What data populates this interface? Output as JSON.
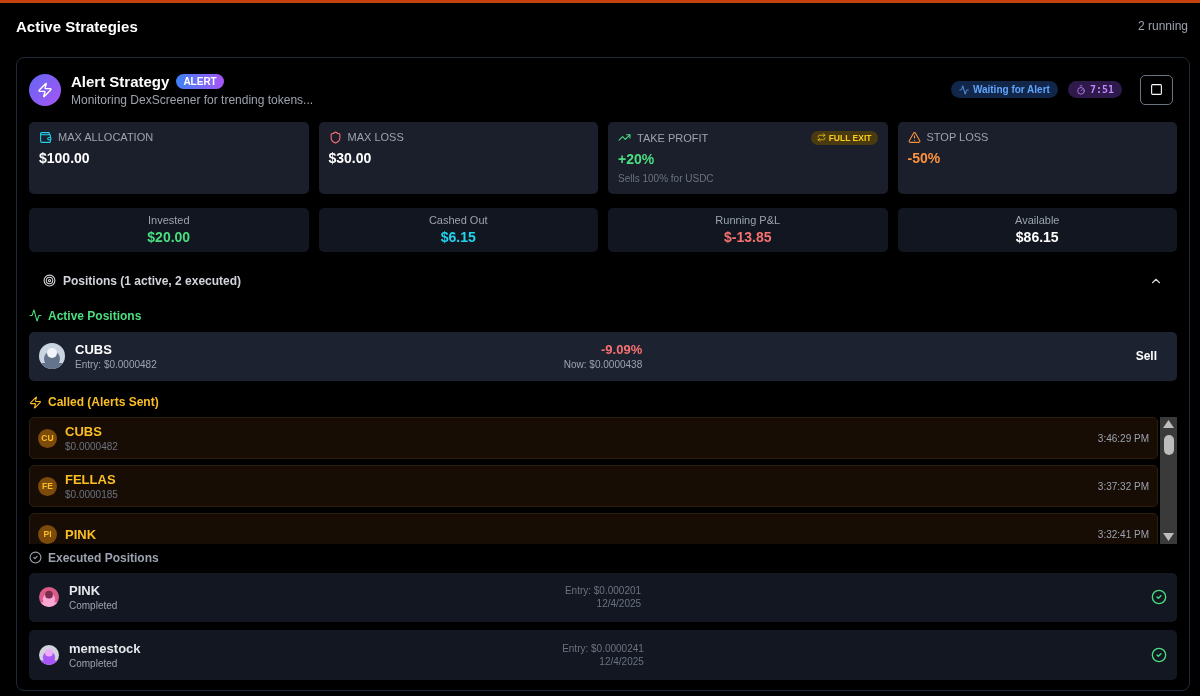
{
  "header": {
    "title": "Active Strategies",
    "count": "2 running"
  },
  "strategy": {
    "name": "Alert Strategy",
    "badge": "ALERT",
    "subtitle": "Monitoring DexScreener for trending tokens...",
    "status": "Waiting for Alert",
    "timer": "7:51"
  },
  "limits": [
    {
      "kind": "allocation",
      "label": "MAX ALLOCATION",
      "value": "$100.00"
    },
    {
      "kind": "loss",
      "label": "MAX LOSS",
      "value": "$30.00"
    },
    {
      "kind": "profit",
      "label": "TAKE PROFIT",
      "value": "+20%",
      "badge": "FULL EXIT",
      "note": "Sells 100% for USDC"
    },
    {
      "kind": "stop",
      "label": "STOP LOSS",
      "value": "-50%"
    }
  ],
  "summary": [
    {
      "kind": "positive",
      "label": "Invested",
      "value": "$20.00"
    },
    {
      "kind": "info",
      "label": "Cashed Out",
      "value": "$6.15"
    },
    {
      "kind": "negative",
      "label": "Running P&L",
      "value": "$-13.85"
    },
    {
      "kind": "neutral",
      "label": "Available",
      "value": "$86.15"
    }
  ],
  "positions": {
    "title": "Positions (1 active, 2 executed)",
    "expanded": true
  },
  "active": {
    "title": "Active Positions",
    "items": [
      {
        "symbol": "CUBS",
        "entry": "Entry: $0.0000482",
        "change": "-9.09%",
        "now": "Now: $0.0000438",
        "action": "Sell"
      }
    ]
  },
  "called": {
    "title": "Called (Alerts Sent)",
    "items": [
      {
        "initials": "CU",
        "symbol": "CUBS",
        "price": "$0.0000482",
        "time": "3:46:29 PM"
      },
      {
        "initials": "FE",
        "symbol": "FELLAS",
        "price": "$0.0000185",
        "time": "3:37:32 PM"
      },
      {
        "initials": "PI",
        "symbol": "PINK",
        "time": "3:32:41 PM"
      }
    ]
  },
  "executed": {
    "title": "Executed Positions",
    "items": [
      {
        "symbol": "PINK",
        "status": "Completed",
        "entry": "Entry: $0.000201",
        "date": "12/4/2025"
      },
      {
        "symbol": "memestock",
        "status": "Completed",
        "entry": "Entry: $0.0000241",
        "date": "12/4/2025"
      }
    ]
  }
}
